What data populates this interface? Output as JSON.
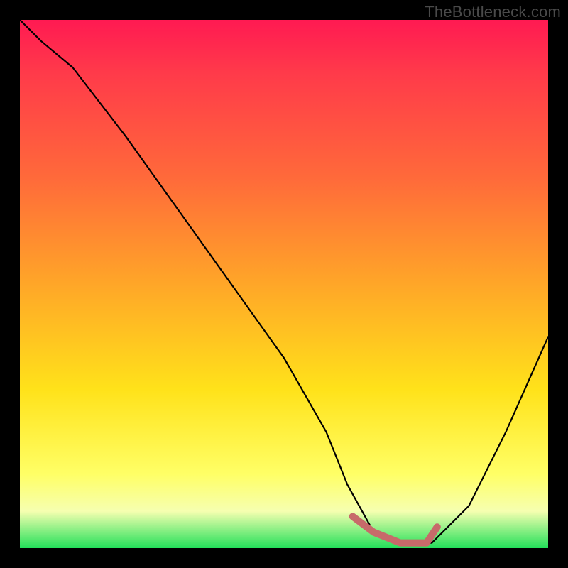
{
  "watermark": "TheBottleneck.com",
  "chart_data": {
    "type": "line",
    "title": "",
    "xlabel": "",
    "ylabel": "",
    "xlim": [
      0,
      100
    ],
    "ylim": [
      0,
      100
    ],
    "grid": false,
    "legend": false,
    "background_gradient": {
      "stops": [
        {
          "pos": 0,
          "color": "#ff1a52"
        },
        {
          "pos": 0.5,
          "color": "#ffa628"
        },
        {
          "pos": 0.86,
          "color": "#ffff66"
        },
        {
          "pos": 1.0,
          "color": "#23e05a"
        }
      ]
    },
    "series": [
      {
        "name": "bottleneck-curve",
        "color": "#000000",
        "x": [
          0,
          4,
          10,
          20,
          30,
          40,
          50,
          58,
          62,
          67,
          72,
          78,
          85,
          92,
          100
        ],
        "y": [
          100,
          96,
          91,
          78,
          64,
          50,
          36,
          22,
          12,
          3,
          1,
          1,
          8,
          22,
          40
        ]
      }
    ],
    "highlight": {
      "name": "optimal-range",
      "color": "#c76a6a",
      "x": [
        63,
        67,
        72,
        77,
        79
      ],
      "y": [
        6,
        3,
        1,
        1,
        4
      ]
    }
  }
}
